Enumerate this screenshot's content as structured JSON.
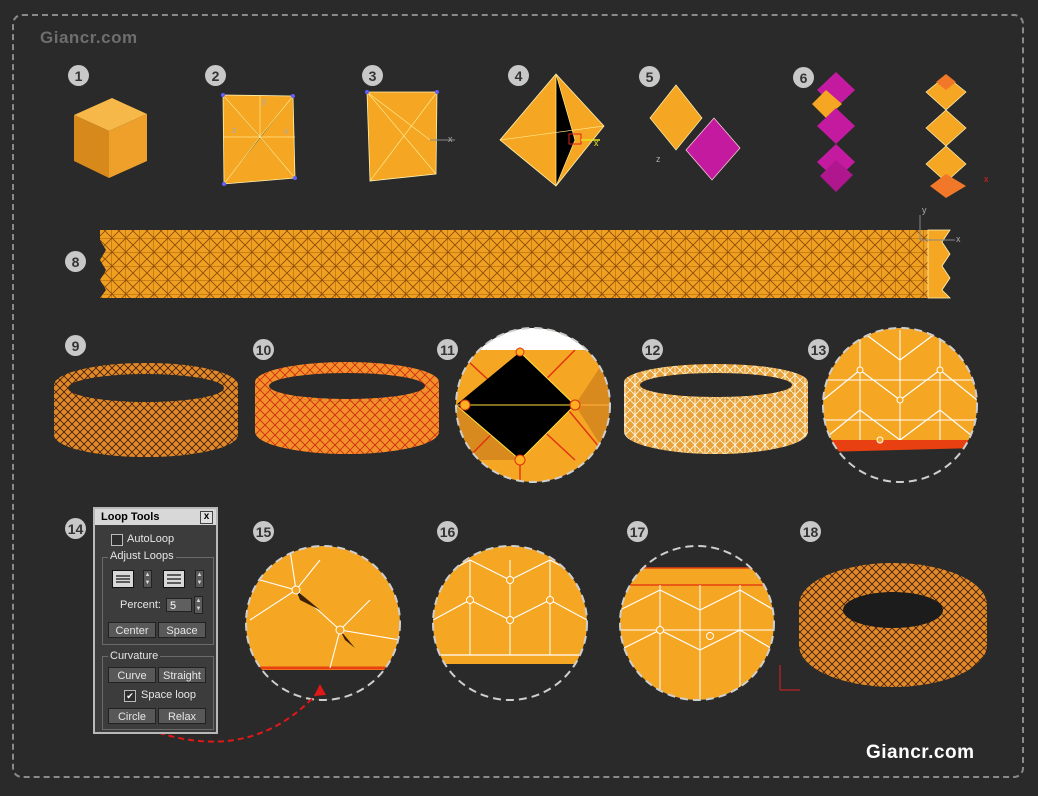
{
  "watermark_top": "Giancr.com",
  "watermark_bottom": "Giancr.com",
  "steps": [
    "1",
    "2",
    "3",
    "4",
    "5",
    "6",
    "8",
    "9",
    "10",
    "11",
    "12",
    "13",
    "14",
    "15",
    "16",
    "17",
    "18"
  ],
  "panel": {
    "title": "Loop Tools",
    "close": "x",
    "autoloop_label": "AutoLoop",
    "adjust_loops_label": "Adjust Loops",
    "percent_label": "Percent:",
    "percent_value": "5",
    "center_label": "Center",
    "space_label": "Space",
    "curvature_label": "Curvature",
    "curve_label": "Curve",
    "straight_label": "Straight",
    "space_loop_label": "Space loop",
    "space_loop_checked": "✔",
    "circle_label": "Circle",
    "relax_label": "Relax"
  },
  "axis_labels": {
    "x": "x",
    "y": "y",
    "z": "z"
  },
  "colors": {
    "orange": "#f5a623",
    "dark_orange": "#c8741a",
    "magenta": "#c41aa0",
    "red_arrow": "#e01818"
  }
}
